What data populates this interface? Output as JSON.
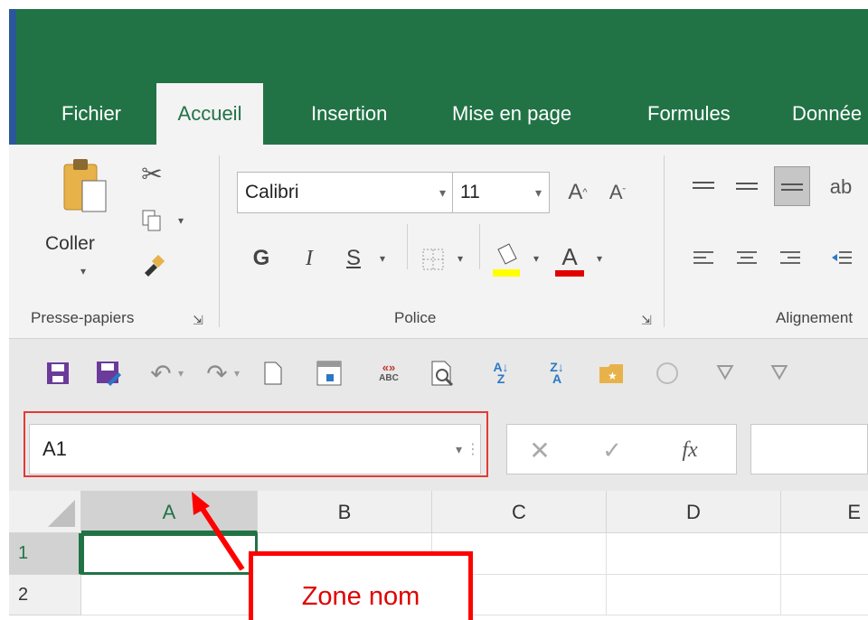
{
  "tabs": [
    "Fichier",
    "Accueil",
    "Insertion",
    "Mise en page",
    "Formules",
    "Donnée"
  ],
  "active_tab": "Accueil",
  "clipboard": {
    "paste_label": "Coller",
    "group_label": "Presse-papiers"
  },
  "font": {
    "name": "Calibri",
    "size": "11",
    "bold": "G",
    "italic": "I",
    "underline": "S",
    "color_letter": "A",
    "group_label": "Police"
  },
  "alignment": {
    "group_label": "Alignement"
  },
  "name_box": {
    "value": "A1"
  },
  "formula_bar": {
    "cancel": "✕",
    "enter": "✓",
    "fx": "fx"
  },
  "columns": [
    "A",
    "B",
    "C",
    "D",
    "E"
  ],
  "rows": [
    "1",
    "2"
  ],
  "annotation": {
    "label": "Zone nom"
  },
  "colors": {
    "excel_green": "#217346",
    "highlight_yellow": "#ffff00",
    "font_red": "#e00000",
    "annotation_red": "#ff0000"
  }
}
